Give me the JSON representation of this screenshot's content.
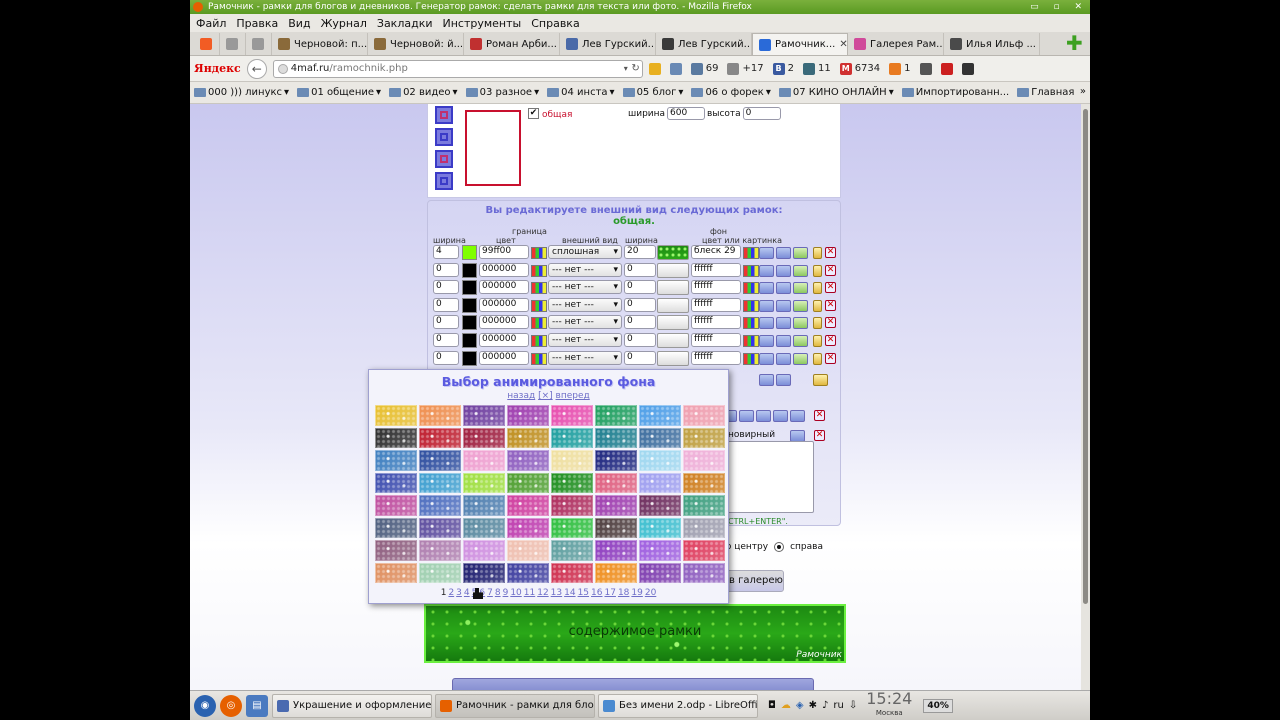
{
  "window": {
    "title": "Рамочник - рамки для блогов и дневников. Генератор рамок: сделать рамки для текста или фото. - Mozilla Firefox",
    "controls": "▭ ▫ ✕"
  },
  "menu": [
    "Файл",
    "Правка",
    "Вид",
    "Журнал",
    "Закладки",
    "Инструменты",
    "Справка"
  ],
  "tabs": [
    {
      "label": "",
      "color": "#f25c24",
      "pinned": true
    },
    {
      "label": "",
      "color": "#999999",
      "pinned": true
    },
    {
      "label": "",
      "color": "#999999",
      "pinned": true
    },
    {
      "label": "Черновой: п...",
      "color": "#8a6a3a"
    },
    {
      "label": "Черновой: й...",
      "color": "#8a6a3a"
    },
    {
      "label": "Роман Арби...",
      "color": "#c03030"
    },
    {
      "label": "Лев Гурский...",
      "color": "#4a6aa8"
    },
    {
      "label": "Лев Гурский...",
      "color": "#3a3a3a"
    },
    {
      "label": "Рамочник...",
      "color": "#2a6ad8",
      "active": true
    },
    {
      "label": "Галерея Рам...",
      "color": "#d04a9a"
    },
    {
      "label": "Илья Ильф ...",
      "color": "#4a4a4a"
    }
  ],
  "newtab": "✚",
  "nav": {
    "yandex": "Яндекс",
    "back": "←",
    "url_host": "4maf.ru",
    "url_path": "/ramochnik.php",
    "url_drop": "▾",
    "reload": "↻",
    "items": [
      {
        "text": "",
        "color": "#e8b020"
      },
      {
        "text": "",
        "color": "#6a8ab5"
      },
      {
        "text": "69",
        "color": "#5a7aa0"
      },
      {
        "text": "+17",
        "color": "#888888"
      },
      {
        "text": "2",
        "color": "#3a5aa0",
        "icon_label": "B"
      },
      {
        "text": "11",
        "color": "#3a6a7a"
      },
      {
        "text": "6734",
        "color": "#d03030",
        "icon_label": "M"
      },
      {
        "text": "1",
        "color": "#e87a20"
      },
      {
        "text": "",
        "color": "#555555"
      },
      {
        "text": "",
        "color": "#cc2020"
      },
      {
        "text": "",
        "color": "#333333"
      }
    ]
  },
  "bookmarks": [
    "000 ))) линукс",
    "01 общение",
    "02 видео",
    "03 разное",
    "04 инста",
    "05 блог",
    "06 о форек",
    "07 КИНО ОНЛАЙН",
    "Импортированн...",
    "Главная"
  ],
  "bookmarks_more": "»",
  "top_panel": {
    "check_mark": "✔",
    "checkbox_label": "общая",
    "width_label": "ширина",
    "width_value": "600",
    "height_label": "высота",
    "height_value": "0"
  },
  "main_panel": {
    "header1": "Вы редактируете внешний вид следующих рамок:",
    "header2": "общая.",
    "group_border": "граница",
    "group_bg": "фон",
    "col_width": "ширина",
    "col_color": "цвет",
    "col_style": "внешний вид",
    "col_bgwidth": "ширина",
    "col_bgcolor": "цвет или картинка",
    "rows": [
      {
        "width": "4",
        "swatch": "#7fff00",
        "color": "99ff00",
        "style": "сплошная",
        "bgwidth": "20",
        "bgvalue": "блеск 29",
        "bgtex": true
      },
      {
        "width": "0",
        "swatch": "#000000",
        "color": "000000",
        "style": "--- нет ---",
        "bgwidth": "0",
        "bgvalue": "ffffff"
      },
      {
        "width": "0",
        "swatch": "#000000",
        "color": "000000",
        "style": "--- нет ---",
        "bgwidth": "0",
        "bgvalue": "ffffff"
      },
      {
        "width": "0",
        "swatch": "#000000",
        "color": "000000",
        "style": "--- нет ---",
        "bgwidth": "0",
        "bgvalue": "ffffff"
      },
      {
        "width": "0",
        "swatch": "#000000",
        "color": "000000",
        "style": "--- нет ---",
        "bgwidth": "0",
        "bgvalue": "ffffff"
      },
      {
        "width": "0",
        "swatch": "#000000",
        "color": "000000",
        "style": "--- нет ---",
        "bgwidth": "0",
        "bgvalue": "ffffff"
      },
      {
        "width": "0",
        "swatch": "#000000",
        "color": "000000",
        "style": "--- нет ---",
        "bgwidth": "0",
        "bgvalue": "ffffff"
      }
    ],
    "partial_label": "новирный",
    "hint": "CTRL+ENTER\".",
    "align_center": "по центру",
    "align_right": "справа",
    "gallery_button": "в галерею"
  },
  "preview": {
    "text": "содержимое рамки",
    "signature": "Рамочник"
  },
  "popup": {
    "title": "Выбор анимированного фона",
    "nav_back": "назад",
    "nav_close": "[×]",
    "nav_forward": "вперед",
    "tile_colors": [
      "#e8c030",
      "#f09050",
      "#7040a0",
      "#a040b0",
      "#e850b0",
      "#20a060",
      "#50a0e8",
      "#f0a0b0",
      "#303030",
      "#c02030",
      "#a02040",
      "#c09020",
      "#20a0a0",
      "#208090",
      "#4070a0",
      "#c0a040",
      "#4080c0",
      "#3050a0",
      "#f0a0d0",
      "#9060c0",
      "#f0e0a0",
      "#202880",
      "#a0d8f0",
      "#f0b0d8",
      "#4050b0",
      "#40a0d0",
      "#a0e040",
      "#50a030",
      "#209020",
      "#e06080",
      "#a0a0f0",
      "#d08020",
      "#c050a0",
      "#5070c0",
      "#5080b0",
      "#d040a0",
      "#b03060",
      "#a040b0",
      "#703060",
      "#40a080",
      "#506080",
      "#6050a0",
      "#5a8aa0",
      "#c040b0",
      "#30c040",
      "#504040",
      "#40c0d0",
      "#a0a0b0",
      "#906080",
      "#b080b0",
      "#d090e0",
      "#f0c0b0",
      "#60a0a0",
      "#9040c0",
      "#a060e0",
      "#e04060",
      "#e09060",
      "#a0d0b0",
      "#202070",
      "#4040a0",
      "#d03050",
      "#f09020",
      "#8040b0",
      "#9060c0"
    ],
    "pages": [
      "1",
      "2",
      "3",
      "4",
      "5",
      "6",
      "7",
      "8",
      "9",
      "10",
      "11",
      "12",
      "13",
      "14",
      "15",
      "16",
      "17",
      "18",
      "19",
      "20"
    ],
    "current_page": "1"
  },
  "taskbar": {
    "tasks": [
      {
        "label": "Украшение и оформление с...",
        "color": "#4a6ab0"
      },
      {
        "label": "Рамочник - рамки для блогов...",
        "color": "#e66000",
        "active": true
      },
      {
        "label": "Без имени 2.odp - LibreOffice...",
        "color": "#4a8ad0"
      }
    ],
    "lang": "ru",
    "clock": "15:24",
    "city": "Москва",
    "battery": "40%"
  }
}
